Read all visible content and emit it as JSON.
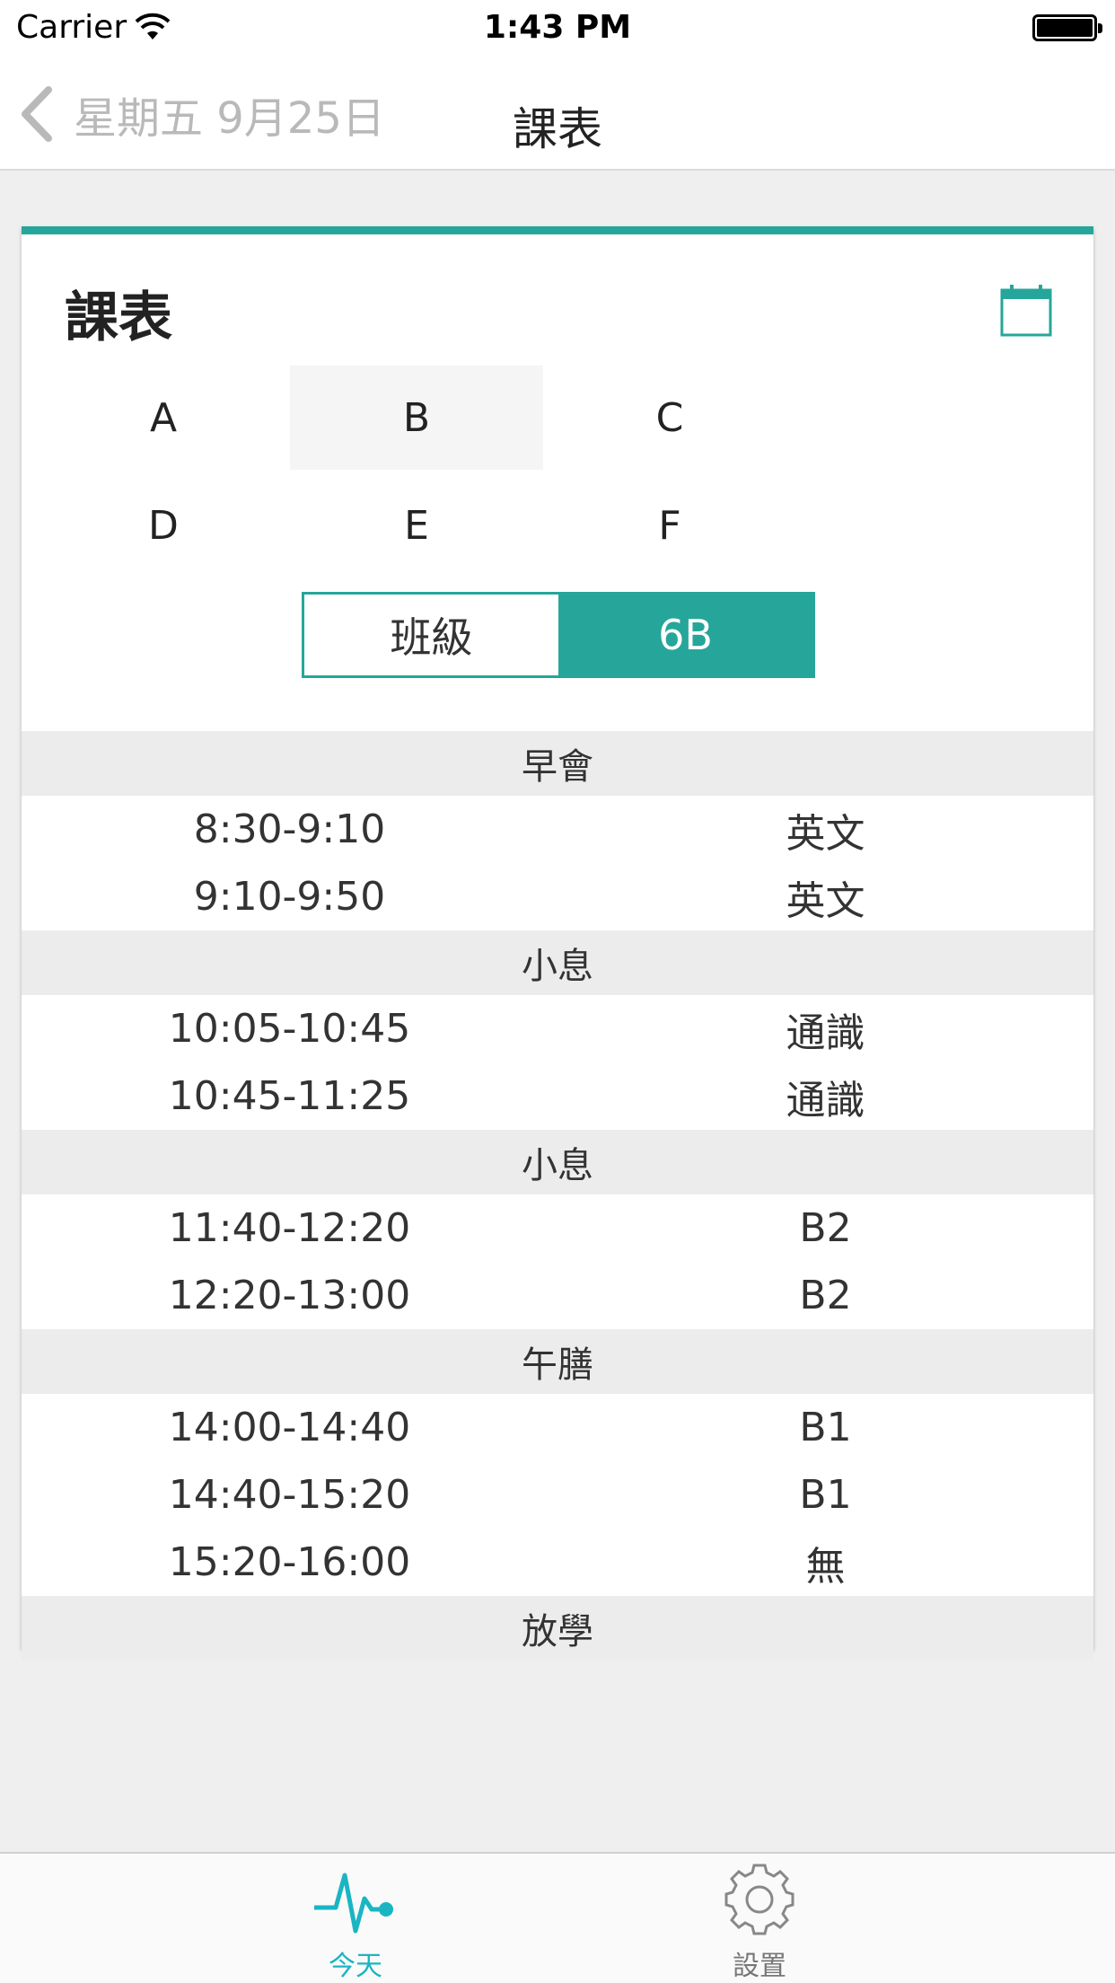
{
  "status_bar": {
    "carrier": "Carrier",
    "time": "1:43 PM"
  },
  "nav": {
    "back_label": "星期五 9月25日",
    "title": "課表"
  },
  "card": {
    "title": "課表",
    "grades": [
      {
        "label": "A",
        "selected": false
      },
      {
        "label": "B",
        "selected": true
      },
      {
        "label": "C",
        "selected": false
      },
      {
        "label": "D",
        "selected": false
      },
      {
        "label": "E",
        "selected": false
      },
      {
        "label": "F",
        "selected": false
      }
    ],
    "segment": {
      "left_label": "班級",
      "right_label": "6B"
    },
    "schedule": [
      {
        "type": "break",
        "label": "早會"
      },
      {
        "type": "lessons",
        "rows": [
          {
            "time": "8:30-9:10",
            "subject": "英文"
          },
          {
            "time": "9:10-9:50",
            "subject": "英文"
          }
        ]
      },
      {
        "type": "break",
        "label": "小息"
      },
      {
        "type": "lessons",
        "rows": [
          {
            "time": "10:05-10:45",
            "subject": "通識"
          },
          {
            "time": "10:45-11:25",
            "subject": "通識"
          }
        ]
      },
      {
        "type": "break",
        "label": "小息"
      },
      {
        "type": "lessons",
        "rows": [
          {
            "time": "11:40-12:20",
            "subject": "B2"
          },
          {
            "time": "12:20-13:00",
            "subject": "B2"
          }
        ]
      },
      {
        "type": "break",
        "label": "午膳"
      },
      {
        "type": "lessons",
        "rows": [
          {
            "time": "14:00-14:40",
            "subject": "B1"
          },
          {
            "time": "14:40-15:20",
            "subject": "B1"
          },
          {
            "time": "15:20-16:00",
            "subject": "無"
          }
        ]
      },
      {
        "type": "break",
        "label": "放學"
      }
    ]
  },
  "tab_bar": {
    "today_label": "今天",
    "settings_label": "設置",
    "active_color": "#1ab5c3",
    "accent_color": "#26a69a"
  }
}
